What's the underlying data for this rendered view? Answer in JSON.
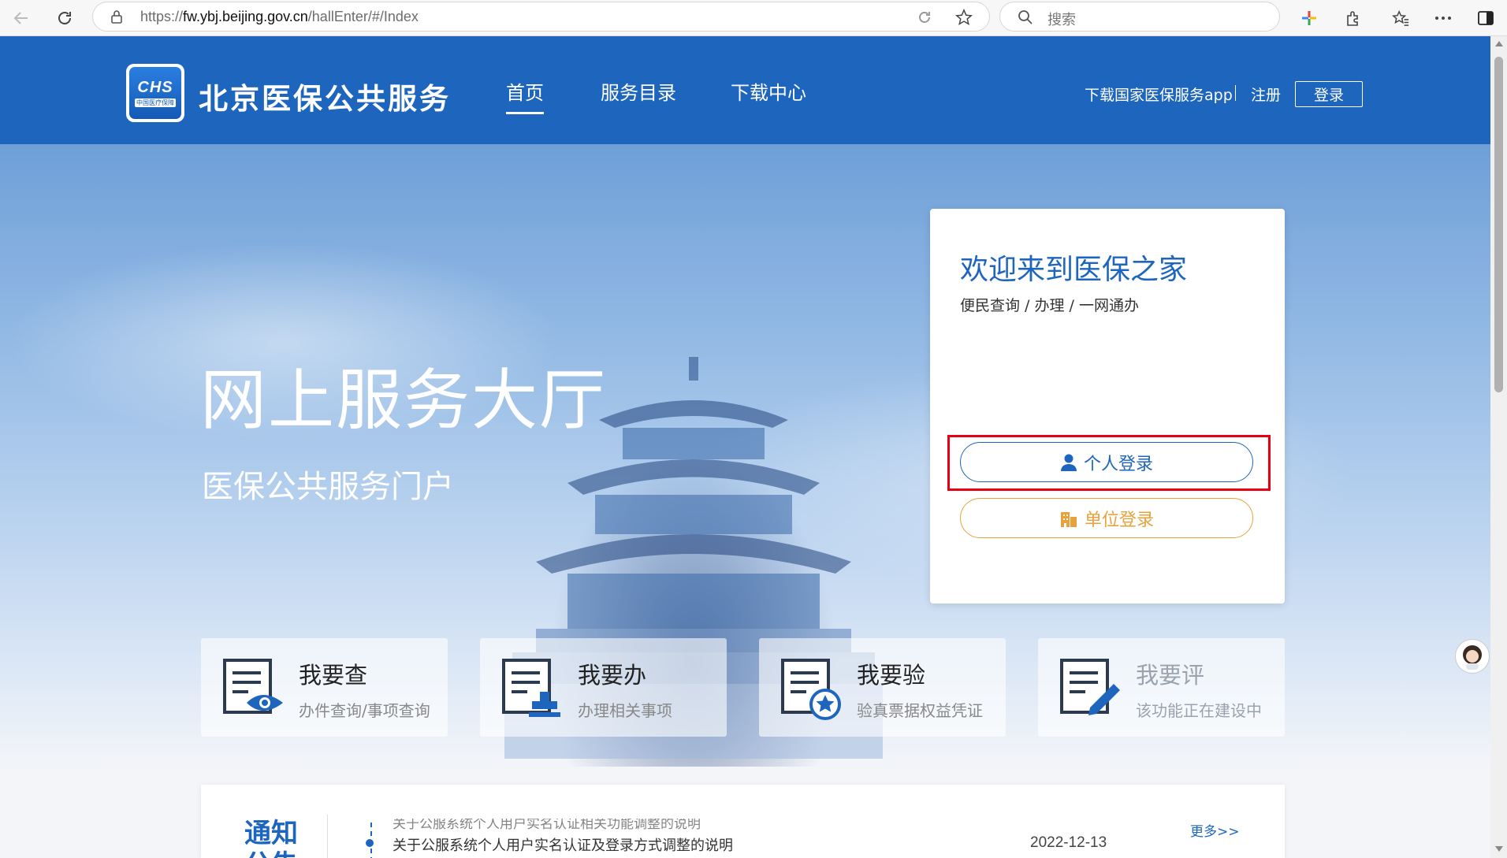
{
  "browser": {
    "url_prefix": "https://",
    "url_host": "fw.ybj.beijing.gov.cn",
    "url_path": "/hallEnter/#/Index",
    "search_placeholder": "搜索"
  },
  "header": {
    "logo_text": "CHS",
    "logo_subtext": "中国医疗保障",
    "site_name": "北京医保公共服务",
    "nav": [
      {
        "label": "首页",
        "active": true
      },
      {
        "label": "服务目录",
        "active": false
      },
      {
        "label": "下载中心",
        "active": false
      }
    ],
    "download_app": "下载国家医保服务app",
    "register": "注册",
    "login": "登录"
  },
  "hero": {
    "title": "网上服务大厅",
    "subtitle": "医保公共服务门户"
  },
  "welcome": {
    "title": "欢迎来到医保之家",
    "subtitle": "便民查询 / 办理 / 一网通办",
    "personal_login": "个人登录",
    "unit_login": "单位登录"
  },
  "cards": [
    {
      "title": "我要查",
      "sub": "办件查询/事项查询",
      "icon": "search-eye-icon"
    },
    {
      "title": "我要办",
      "sub": "办理相关事项",
      "icon": "stamp-icon"
    },
    {
      "title": "我要验",
      "sub": "验真票据权益凭证",
      "icon": "verify-star-icon"
    },
    {
      "title": "我要评",
      "sub": "该功能正在建设中",
      "icon": "pen-icon"
    }
  ],
  "notice": {
    "heading": "通知公告",
    "prev_item": "关于公服系统个人用户实名认证相关功能调整的说明",
    "item_text": "关于公服系统个人用户实名认证及登录方式调整的说明",
    "item_date": "2022-12-13",
    "more": "更多>>"
  },
  "colors": {
    "brand_blue": "#1e66bd",
    "unit_orange": "#e8a13b",
    "highlight_red": "#e60012"
  }
}
